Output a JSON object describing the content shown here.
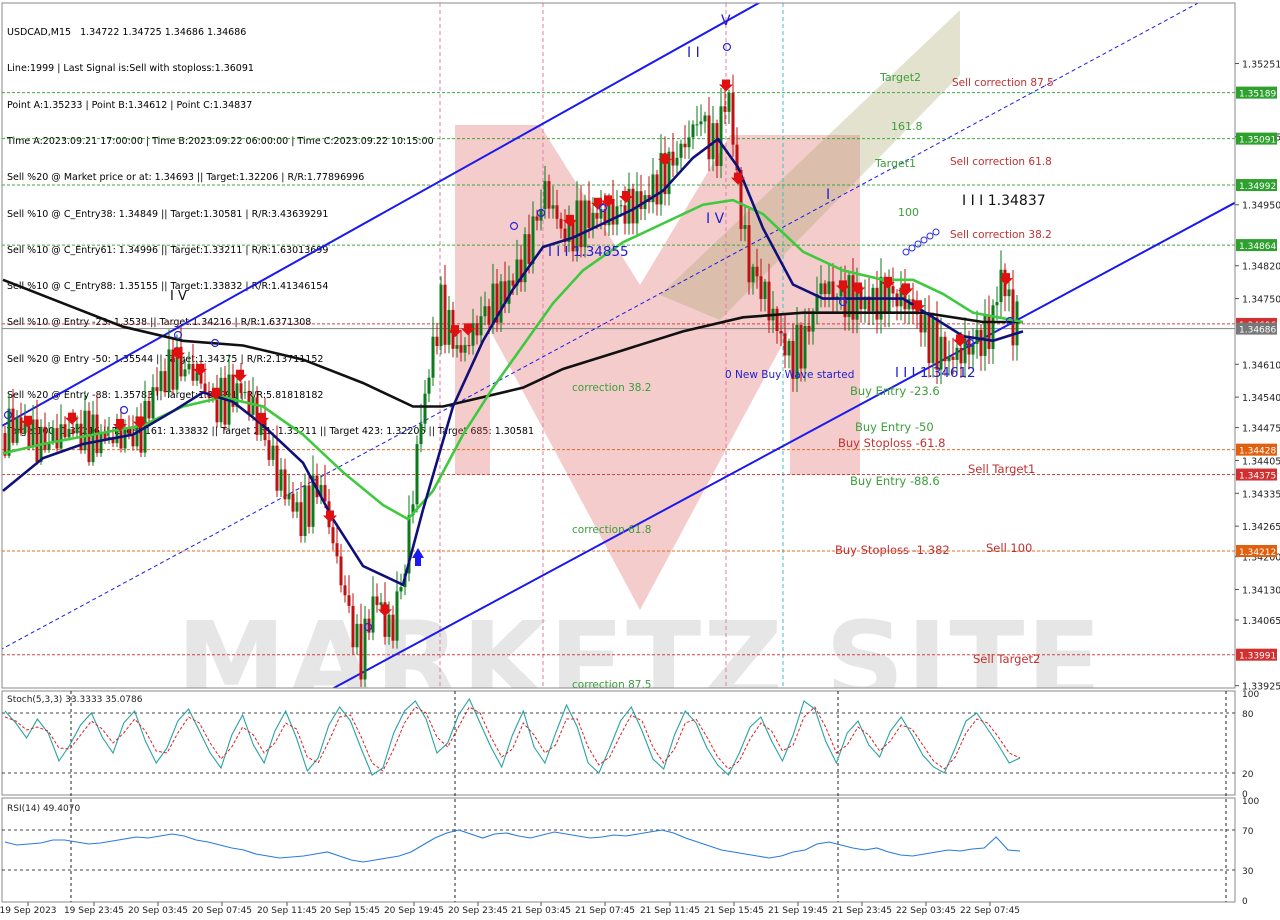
{
  "header": {
    "symbol_line": "USDCAD,M15   1.34722 1.34725 1.34686 1.34686",
    "lines": [
      "Line:1999 | Last Signal is:Sell with stoploss:1.36091",
      "Point A:1.35233 | Point B:1.34612 | Point C:1.34837",
      "Time A:2023.09.21 17:00:00 | Time B:2023.09.22 06:00:00 | Time C:2023.09.22 10:15:00",
      "Sell %20 @ Market price or at: 1.34693 || Target:1.32206 | R/R:1.77896996",
      "Sell %10 @ C_Entry38: 1.34849 || Target:1.30581 | R/R:3.43639291",
      "Sell %10 @ C_Entry61: 1.34996 || Target:1.33211 | R/R:1.63013699",
      "Sell %10 @ C_Entry88: 1.35155 || Target:1.33832 | R/R:1.41346154",
      "Sell %10 @ Entry -23: 1.3538 || Target:1.34216 | R/R:1.6371308",
      "Sell %20 @ Entry -50: 1.35544 || Target:1.34375 | R/R:2.13711152",
      "Sell %20 @ Entry -88: 1.35783 || Target:1.33991 | R/R:5.81818182",
      "Target100: 1.34216 || Target 161: 1.33832 || Target 261: 1.33211 || Target 423: 1.32206 || Target 685: 1.30581"
    ]
  },
  "colors": {
    "background": "#ffffff",
    "bull_candle": "#0a7a1a",
    "bear_candle": "#c01010",
    "channel": "#1a1aee",
    "ma_fast": "#10107a",
    "ma_mid": "#3ec93e",
    "ma_slow": "#111111",
    "level_red": "#d03030",
    "level_green": "#2ea02e",
    "watermark": "#e06060"
  },
  "chart_data": {
    "type": "candlestick",
    "symbol": "USDCAD",
    "timeframe": "M15",
    "ylim": [
      1.3392,
      1.3538
    ],
    "price_ticks": [
      "1.35251",
      "1.35095",
      "1.34950",
      "1.34820",
      "1.34750",
      "1.34610",
      "1.34540",
      "1.34475",
      "1.34405",
      "1.34335",
      "1.34265",
      "1.34200",
      "1.34130",
      "1.34065",
      "1.33925"
    ],
    "time_labels": [
      "19 Sep 2023",
      "19 Sep 23:45",
      "20 Sep 03:45",
      "20 Sep 07:45",
      "20 Sep 11:45",
      "20 Sep 15:45",
      "20 Sep 19:45",
      "20 Sep 23:45",
      "21 Sep 03:45",
      "21 Sep 07:45",
      "21 Sep 11:45",
      "21 Sep 15:45",
      "21 Sep 19:45",
      "21 Sep 23:45",
      "22 Sep 03:45",
      "22 Sep 07:45"
    ],
    "price_path": [
      [
        0,
        1.3446
      ],
      [
        18,
        1.3448
      ],
      [
        40,
        1.3444
      ],
      [
        70,
        1.3447
      ],
      [
        100,
        1.3445
      ],
      [
        140,
        1.3446
      ],
      [
        155,
        1.3456
      ],
      [
        175,
        1.3461
      ],
      [
        195,
        1.3459
      ],
      [
        215,
        1.3452
      ],
      [
        240,
        1.3456
      ],
      [
        260,
        1.3448
      ],
      [
        280,
        1.3436
      ],
      [
        300,
        1.3428
      ],
      [
        320,
        1.3436
      ],
      [
        340,
        1.3416
      ],
      [
        360,
        1.3398
      ],
      [
        375,
        1.3412
      ],
      [
        390,
        1.3403
      ],
      [
        405,
        1.3418
      ],
      [
        420,
        1.3448
      ],
      [
        440,
        1.3473
      ],
      [
        460,
        1.3463
      ],
      [
        485,
        1.3472
      ],
      [
        505,
        1.3476
      ],
      [
        525,
        1.3484
      ],
      [
        545,
        1.3498
      ],
      [
        565,
        1.3488
      ],
      [
        585,
        1.3492
      ],
      [
        605,
        1.3493
      ],
      [
        625,
        1.3494
      ],
      [
        645,
        1.3496
      ],
      [
        665,
        1.3502
      ],
      [
        685,
        1.3508
      ],
      [
        700,
        1.3514
      ],
      [
        715,
        1.3506
      ],
      [
        728,
        1.352
      ],
      [
        738,
        1.3498
      ],
      [
        748,
        1.3482
      ],
      [
        760,
        1.3478
      ],
      [
        775,
        1.347
      ],
      [
        790,
        1.3462
      ],
      [
        805,
        1.3466
      ],
      [
        820,
        1.3478
      ],
      [
        835,
        1.3476
      ],
      [
        850,
        1.3475
      ],
      [
        870,
        1.3474
      ],
      [
        890,
        1.3476
      ],
      [
        910,
        1.3474
      ],
      [
        930,
        1.3466
      ],
      [
        950,
        1.3462
      ],
      [
        970,
        1.3465
      ],
      [
        990,
        1.3468
      ],
      [
        1002,
        1.3481
      ],
      [
        1012,
        1.347
      ],
      [
        1020,
        1.3469
      ]
    ],
    "ma_fast_path": [
      [
        0,
        1.3434
      ],
      [
        40,
        1.3441
      ],
      [
        80,
        1.3444
      ],
      [
        130,
        1.3446
      ],
      [
        170,
        1.3451
      ],
      [
        200,
        1.3455
      ],
      [
        230,
        1.3453
      ],
      [
        260,
        1.3448
      ],
      [
        300,
        1.344
      ],
      [
        330,
        1.3428
      ],
      [
        360,
        1.3418
      ],
      [
        400,
        1.3414
      ],
      [
        420,
        1.343
      ],
      [
        450,
        1.3452
      ],
      [
        480,
        1.3466
      ],
      [
        510,
        1.3477
      ],
      [
        540,
        1.3486
      ],
      [
        570,
        1.3488
      ],
      [
        600,
        1.3491
      ],
      [
        630,
        1.3494
      ],
      [
        660,
        1.3498
      ],
      [
        690,
        1.3505
      ],
      [
        715,
        1.3509
      ],
      [
        735,
        1.3503
      ],
      [
        760,
        1.349
      ],
      [
        790,
        1.3478
      ],
      [
        820,
        1.3475
      ],
      [
        860,
        1.3475
      ],
      [
        900,
        1.3475
      ],
      [
        930,
        1.3471
      ],
      [
        960,
        1.3467
      ],
      [
        990,
        1.3466
      ],
      [
        1020,
        1.3468
      ]
    ],
    "ma_mid_path": [
      [
        0,
        1.3442
      ],
      [
        40,
        1.3444
      ],
      [
        90,
        1.3446
      ],
      [
        140,
        1.3448
      ],
      [
        180,
        1.3452
      ],
      [
        220,
        1.3454
      ],
      [
        260,
        1.3452
      ],
      [
        300,
        1.3446
      ],
      [
        340,
        1.3438
      ],
      [
        380,
        1.3431
      ],
      [
        405,
        1.3428
      ],
      [
        430,
        1.3434
      ],
      [
        460,
        1.3446
      ],
      [
        490,
        1.3456
      ],
      [
        520,
        1.3465
      ],
      [
        550,
        1.3474
      ],
      [
        580,
        1.3481
      ],
      [
        620,
        1.3487
      ],
      [
        660,
        1.3491
      ],
      [
        700,
        1.3495
      ],
      [
        730,
        1.3496
      ],
      [
        760,
        1.3493
      ],
      [
        800,
        1.3485
      ],
      [
        840,
        1.3481
      ],
      [
        880,
        1.3479
      ],
      [
        910,
        1.3479
      ],
      [
        940,
        1.3476
      ],
      [
        970,
        1.3472
      ],
      [
        1020,
        1.347
      ]
    ],
    "ma_slow_path": [
      [
        0,
        1.3479
      ],
      [
        60,
        1.3474
      ],
      [
        120,
        1.3469
      ],
      [
        180,
        1.3466
      ],
      [
        240,
        1.3465
      ],
      [
        300,
        1.3462
      ],
      [
        360,
        1.3457
      ],
      [
        410,
        1.3452
      ],
      [
        440,
        1.3452
      ],
      [
        480,
        1.3454
      ],
      [
        520,
        1.3456
      ],
      [
        560,
        1.346
      ],
      [
        620,
        1.3464
      ],
      [
        680,
        1.3468
      ],
      [
        740,
        1.3471
      ],
      [
        800,
        1.3472
      ],
      [
        860,
        1.3472
      ],
      [
        920,
        1.3472
      ],
      [
        980,
        1.347
      ],
      [
        1020,
        1.347
      ]
    ],
    "price_markers": [
      {
        "label": "1.35189",
        "price": 1.35189,
        "color": "#2ea02e"
      },
      {
        "label": "1.35091",
        "price": 1.35091,
        "color": "#2ea02e"
      },
      {
        "label": "1.34992",
        "price": 1.34992,
        "color": "#2ea02e"
      },
      {
        "label": "1.34864",
        "price": 1.34864,
        "color": "#2ea02e"
      },
      {
        "label": "1.34696",
        "price": 1.34696,
        "color": "#d03030"
      },
      {
        "label": "1.34686",
        "price": 1.34686,
        "color": "#777777"
      },
      {
        "label": "1.34428",
        "price": 1.34428,
        "color": "#e06010"
      },
      {
        "label": "1.34375",
        "price": 1.34375,
        "color": "#d03030"
      },
      {
        "label": "1.34212",
        "price": 1.34212,
        "color": "#e06010"
      },
      {
        "label": "1.33991",
        "price": 1.33991,
        "color": "#d03030"
      }
    ],
    "annotations": [
      {
        "text": "Target2",
        "color": "#3aa03a"
      },
      {
        "text": "161.8",
        "color": "#3aa03a"
      },
      {
        "text": "Target1",
        "color": "#3aa03a"
      },
      {
        "text": "100",
        "color": "#3aa03a"
      },
      {
        "text": "Sell correction 87.5",
        "color": "#c03030"
      },
      {
        "text": "Sell correction 61.8",
        "color": "#c03030"
      },
      {
        "text": "Sell correction 38.2",
        "color": "#c03030"
      },
      {
        "text": "I I I 1.34837",
        "color": "#111111"
      },
      {
        "text": "I I I 1.34855",
        "color": "#2020cc"
      },
      {
        "text": "I I I 1.34612",
        "color": "#2020cc"
      },
      {
        "text": "correction 38.2",
        "color": "#3aa03a"
      },
      {
        "text": "correction 61.8",
        "color": "#3aa03a"
      },
      {
        "text": "correction 87.5",
        "color": "#3aa03a"
      },
      {
        "text": "0 New Buy Wave started",
        "color": "#2020cc"
      },
      {
        "text": "Buy Entry -23.6",
        "color": "#3aa03a"
      },
      {
        "text": "Buy Entry -50",
        "color": "#3aa03a"
      },
      {
        "text": "Buy Stoploss -61.8",
        "color": "#c03030"
      },
      {
        "text": "Buy Entry -88.6",
        "color": "#3aa03a"
      },
      {
        "text": "Buy Stoploss -1.382",
        "color": "#c03030"
      },
      {
        "text": "Sell Target1",
        "color": "#c03030"
      },
      {
        "text": "Sell 100",
        "color": "#c03030"
      },
      {
        "text": "Sell Target2",
        "color": "#c03030"
      },
      {
        "text": "I V",
        "color": "#111111"
      },
      {
        "text": "V",
        "color": "#2020cc"
      },
      {
        "text": "I I",
        "color": "#2020cc"
      },
      {
        "text": "I V",
        "color": "#2020cc"
      },
      {
        "text": "I",
        "color": "#2020cc"
      }
    ],
    "stochastic": {
      "label": "Stoch(5,3,3) 33.3333 35.0786",
      "ticks": [
        "100",
        "80",
        "20",
        "0"
      ],
      "k_values": [
        82,
        70,
        55,
        74,
        60,
        32,
        48,
        68,
        80,
        56,
        40,
        70,
        82,
        52,
        30,
        45,
        72,
        84,
        62,
        40,
        25,
        58,
        78,
        48,
        30,
        62,
        82,
        55,
        22,
        35,
        68,
        86,
        72,
        44,
        18,
        25,
        60,
        82,
        92,
        74,
        40,
        50,
        78,
        94,
        70,
        46,
        26,
        58,
        82,
        46,
        30,
        60,
        88,
        66,
        30,
        20,
        45,
        72,
        86,
        62,
        34,
        24,
        58,
        82,
        70,
        45,
        28,
        18,
        40,
        66,
        76,
        52,
        32,
        58,
        92,
        84,
        52,
        30,
        60,
        72,
        48,
        36,
        62,
        76,
        58,
        38,
        26,
        20,
        45,
        72,
        80,
        64,
        48,
        30,
        35
      ],
      "d_values": [
        76,
        72,
        63,
        66,
        62,
        45,
        44,
        58,
        72,
        64,
        50,
        60,
        74,
        62,
        42,
        40,
        60,
        76,
        70,
        50,
        34,
        46,
        66,
        58,
        40,
        50,
        70,
        64,
        36,
        30,
        52,
        76,
        78,
        56,
        30,
        22,
        44,
        70,
        86,
        80,
        56,
        46,
        66,
        86,
        80,
        56,
        36,
        44,
        70,
        58,
        40,
        48,
        74,
        74,
        46,
        28,
        36,
        58,
        78,
        72,
        46,
        30,
        44,
        70,
        74,
        56,
        36,
        24,
        32,
        54,
        70,
        62,
        42,
        48,
        76,
        86,
        66,
        40,
        48,
        66,
        58,
        42,
        52,
        68,
        64,
        48,
        32,
        24,
        36,
        60,
        74,
        70,
        56,
        40,
        35
      ]
    },
    "rsi": {
      "label": "RSI(14) 49.4070",
      "ticks": [
        "100",
        "70",
        "30",
        "0"
      ],
      "values": [
        58,
        55,
        56,
        57,
        60,
        60,
        58,
        56,
        57,
        59,
        61,
        63,
        62,
        64,
        66,
        64,
        60,
        58,
        55,
        52,
        50,
        46,
        44,
        42,
        43,
        44,
        46,
        48,
        44,
        40,
        38,
        40,
        42,
        44,
        48,
        55,
        62,
        67,
        70,
        66,
        62,
        66,
        67,
        64,
        62,
        65,
        68,
        66,
        64,
        62,
        63,
        65,
        64,
        66,
        68,
        70,
        67,
        62,
        58,
        54,
        50,
        48,
        46,
        44,
        42,
        44,
        48,
        50,
        56,
        58,
        55,
        52,
        50,
        52,
        48,
        45,
        44,
        46,
        48,
        50,
        49,
        51,
        52,
        63,
        50,
        49
      ]
    }
  }
}
